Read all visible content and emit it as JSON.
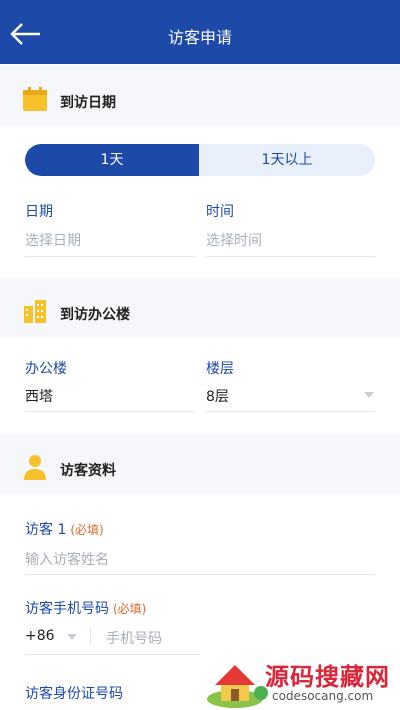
{
  "header": {
    "title": "访客申请"
  },
  "sections": {
    "visit_date": "到访日期",
    "office": "到访办公楼",
    "visitor_info": "访客资料"
  },
  "duration_tabs": [
    "1天",
    "1天以上"
  ],
  "date_time": {
    "date_label": "日期",
    "date_placeholder": "选择日期",
    "time_label": "时间",
    "time_placeholder": "选择时间"
  },
  "office": {
    "building_label": "办公楼",
    "building_value": "西塔",
    "floor_label": "楼层",
    "floor_value": "8层"
  },
  "visitor": {
    "name_label": "访客 1",
    "required_tag": "(必填)",
    "name_placeholder": "输入访客姓名",
    "phone_label": "访客手机号码",
    "country_code": "+86",
    "phone_placeholder": "手机号码",
    "id_label": "访客身份证号码"
  },
  "watermark": {
    "title": "源码搜藏网",
    "site": "codesocang.com"
  },
  "colors": {
    "primary": "#1d49a8",
    "accent_yellow": "#f6c12a",
    "required": "#e26a2c"
  }
}
